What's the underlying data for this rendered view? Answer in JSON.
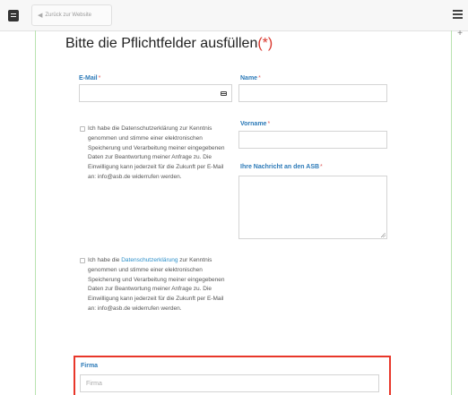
{
  "topbar": {
    "doc_icon": "document-icon",
    "back_label": "Zurück zur Website",
    "menu_icon": "hamburger-menu-icon",
    "plus_icon": "plus-icon"
  },
  "form": {
    "title": "Bitte die Pflichtfelder ausfüllen",
    "title_required": "(*)",
    "required_star": "*",
    "email_label": "E-Mail",
    "name_label": "Name",
    "vorname_label": "Vorname",
    "nachricht_label": "Ihre Nachricht an den ASB",
    "firma_label": "Firma",
    "firma_placeholder": "Firma",
    "consent_1": "Ich habe die Datenschutzerklärung zur Kenntnis genommen und stimme einer elektronischen Speicherung und Verarbeitung meiner eingegebenen Daten zur Beantwortung meiner Anfrage zu. Die Einwilligung kann jederzeit für die Zukunft per E-Mail an: info@asb.de widerrufen werden.",
    "consent_2_before": "Ich habe die ",
    "consent_2_link": "Datenschutzerklärung",
    "consent_2_after": " zur Kenntnis genommen und stimme einer elektronischen Speicherung und Verarbeitung meiner eingegebenen Daten zur Beantwortung meiner Anfrage zu. Die Einwilligung kann jederzeit für die Zukunft per E-Mail an: info@asb.de widerrufen werden."
  },
  "colors": {
    "label": "#2c7ab8",
    "required": "#d9352b",
    "highlight": "#e8372a",
    "guide": "#b9e3b0"
  }
}
